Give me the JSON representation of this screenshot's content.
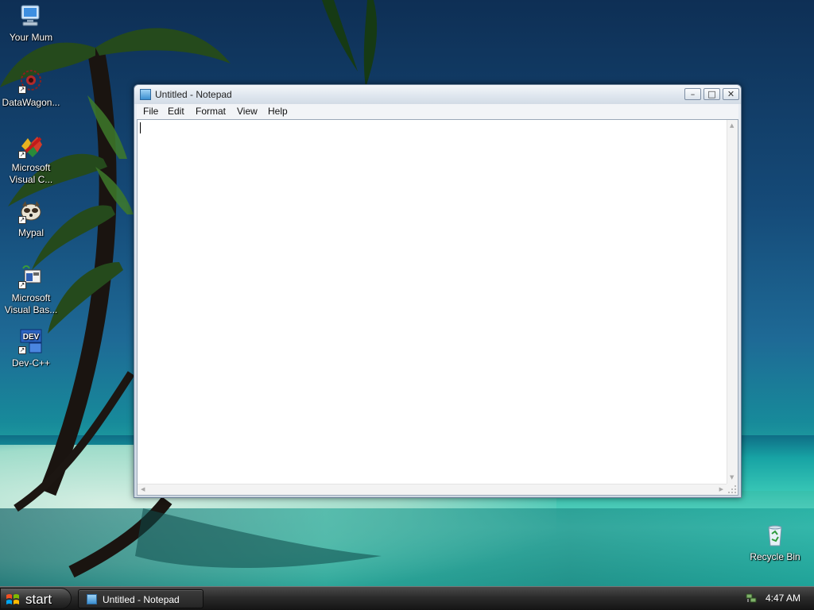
{
  "desktop": {
    "icons": [
      {
        "label": "Your Mum",
        "icon": "computer-icon"
      },
      {
        "label": "DataWagon...",
        "icon": "datawagon-icon"
      },
      {
        "label": "Microsoft Visual C...",
        "icon": "visual-c-icon"
      },
      {
        "label": "Mypal",
        "icon": "mypal-icon"
      },
      {
        "label": "Microsoft Visual Bas...",
        "icon": "visual-basic-icon"
      },
      {
        "label": "Dev-C++",
        "icon": "dev-cpp-icon"
      },
      {
        "label": "Recycle Bin",
        "icon": "recycle-bin-icon"
      }
    ],
    "dev_icon_text": "DEV"
  },
  "window": {
    "title": "Untitled - Notepad",
    "caption_buttons": {
      "minimize": "–",
      "maximize": "□",
      "close": "✕"
    },
    "menu": [
      "File",
      "Edit",
      "Format",
      "View",
      "Help"
    ],
    "content": ""
  },
  "taskbar": {
    "start_label": "start",
    "task_button_label": "Untitled - Notepad",
    "clock": "4:47 AM"
  },
  "colors": {
    "taskbar": "#1e1e1e",
    "window_frame": "#d3dce6",
    "sea": "#2bb9a6",
    "sky": "#154a78"
  }
}
